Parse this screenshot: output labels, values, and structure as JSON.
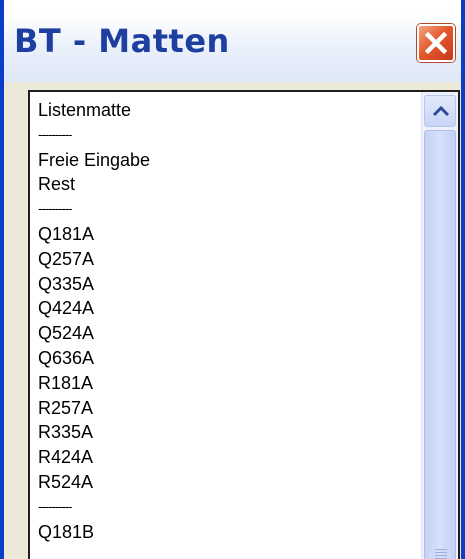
{
  "window": {
    "title": "BT - Matten"
  },
  "icons": {
    "close": "close-icon",
    "scroll_up": "chevron-up-icon",
    "grip": "grip-icon"
  },
  "colors": {
    "title_text": "#1f3fa0",
    "window_border": "#0a3ec7",
    "close_button": "#e35a2d",
    "scrollbar": "#c6d3f6"
  },
  "list": {
    "items": [
      "Listenmatte",
      "----------",
      "Freie Eingabe",
      "Rest",
      "----------",
      "Q181A",
      "Q257A",
      "Q335A",
      "Q424A",
      "Q524A",
      "Q636A",
      "R181A",
      "R257A",
      "R335A",
      "R424A",
      "R524A",
      "----------",
      "Q181B"
    ]
  }
}
